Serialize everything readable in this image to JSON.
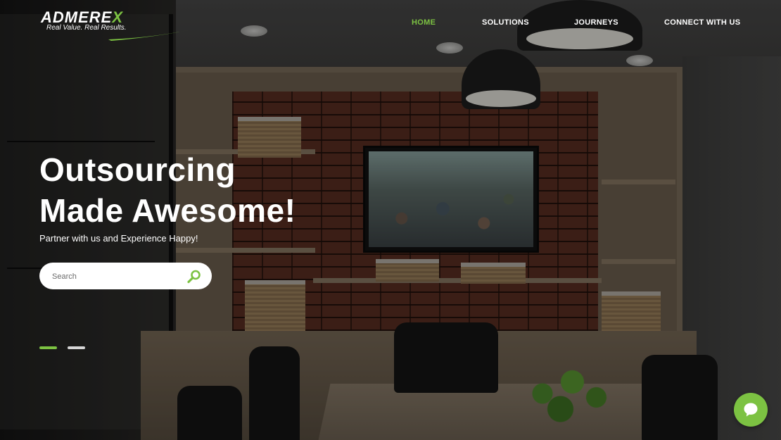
{
  "brand": {
    "name_main": "ADMERE",
    "name_accent": "X",
    "tagline": "Real Value. Real Results.",
    "accent_color": "#7cc242"
  },
  "nav": {
    "items": [
      {
        "label": "HOME",
        "active": true
      },
      {
        "label": "SOLUTIONS",
        "active": false
      },
      {
        "label": "JOURNEYS",
        "active": false
      },
      {
        "label": "CONNECT WITH US",
        "active": false
      }
    ]
  },
  "hero": {
    "title_line1": "Outsourcing",
    "title_line2": "Made Awesome!",
    "subtitle": "Partner with us and Experience Happy!"
  },
  "search": {
    "placeholder": "Search",
    "icon": "search-icon"
  },
  "carousel": {
    "slide_count": 2,
    "active_index": 0
  },
  "chat": {
    "icon": "chat-bubble-icon"
  }
}
